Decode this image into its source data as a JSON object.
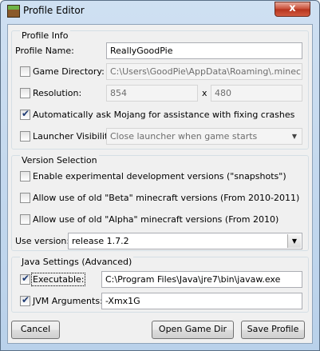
{
  "window": {
    "title": "Profile Editor",
    "close_glyph": "x"
  },
  "profile_info": {
    "title": "Profile Info",
    "name_label": "Profile Name:",
    "name_value": "ReallyGoodPie",
    "game_dir": {
      "label": "Game Directory:",
      "checked": false,
      "value": "C:\\Users\\GoodPie\\AppData\\Roaming\\.minecraft"
    },
    "resolution": {
      "label": "Resolution:",
      "checked": false,
      "width": "854",
      "sep": "x",
      "height": "480"
    },
    "auto_crash": {
      "label": "Automatically ask Mojang for assistance with fixing crashes",
      "checked": true
    },
    "visibility": {
      "label": "Launcher Visibility:",
      "checked": false,
      "value": "Close launcher when game starts"
    }
  },
  "version_selection": {
    "title": "Version Selection",
    "snapshots": {
      "label": "Enable experimental development versions (\"snapshots\")",
      "checked": false
    },
    "beta": {
      "label": "Allow use of old \"Beta\" minecraft versions (From 2010-2011)",
      "checked": false
    },
    "alpha": {
      "label": "Allow use of old \"Alpha\" minecraft versions (From 2010)",
      "checked": false
    },
    "use_version_label": "Use version:",
    "use_version_value": "release 1.7.2"
  },
  "java_settings": {
    "title": "Java Settings (Advanced)",
    "executable": {
      "label": "Executable:",
      "checked": true,
      "value": "C:\\Program Files\\Java\\jre7\\bin\\javaw.exe"
    },
    "jvm_args": {
      "label": "JVM Arguments:",
      "checked": true,
      "value": "-Xmx1G"
    }
  },
  "buttons": {
    "cancel": "Cancel",
    "open_game_dir": "Open Game Dir",
    "save_profile": "Save Profile"
  }
}
